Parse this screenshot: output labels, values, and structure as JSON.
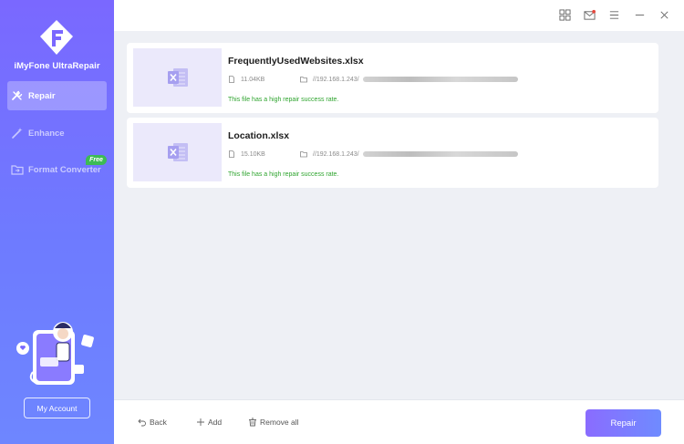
{
  "app": {
    "name": "iMyFone UltraRepair"
  },
  "sidebar": {
    "items": [
      {
        "label": "Repair",
        "icon": "tools-icon",
        "active": true
      },
      {
        "label": "Enhance",
        "icon": "magic-wand-icon",
        "active": false
      },
      {
        "label": "Format Converter",
        "icon": "folder-convert-icon",
        "active": false,
        "badge": "Free"
      }
    ],
    "account_label": "My Account"
  },
  "titlebar": {
    "icons": [
      "grid-icon",
      "mail-icon",
      "menu-icon",
      "minimize-icon",
      "close-icon"
    ]
  },
  "files": [
    {
      "name": "FrequentlyUsedWebsites.xlsx",
      "size": "11.04KB",
      "path": "//192.168.1.243/",
      "status": "This file has a high repair success rate."
    },
    {
      "name": "Location.xlsx",
      "size": "15.10KB",
      "path": "//192.168.1.243/",
      "status": "This file has a high repair success rate."
    }
  ],
  "bottombar": {
    "back_label": "Back",
    "add_label": "Add",
    "remove_all_label": "Remove all",
    "repair_label": "Repair"
  },
  "colors": {
    "sidebar_top": "#7a68ff",
    "sidebar_bottom": "#6e86ff",
    "status_green": "#2ea42e",
    "badge_green": "#3dbb55",
    "mail_dot": "#e5483d"
  }
}
